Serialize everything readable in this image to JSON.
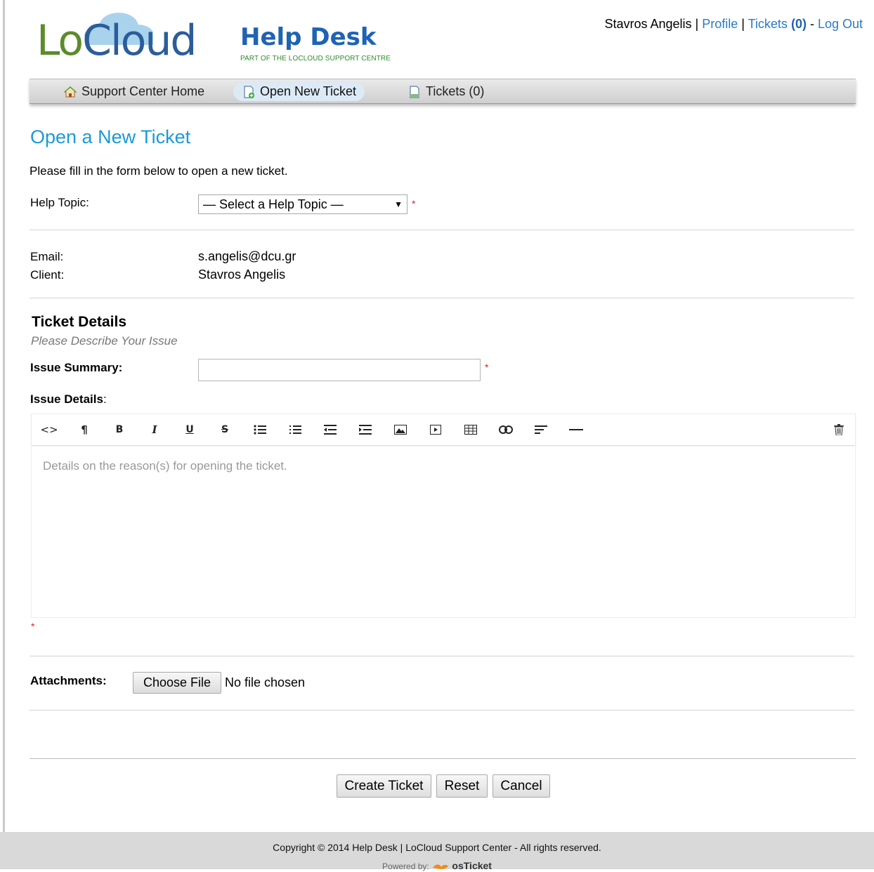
{
  "brand": {
    "logo_lo": "Lo",
    "logo_cloud": "Cloud",
    "logo_helpdesk": "Help Desk",
    "logo_sub": "PART OF THE LOCLOUD SUPPORT CENTRE",
    "colors": {
      "lo_green": "#5b8c2a",
      "cloud_blue": "#2b5d9a",
      "helpdesk_blue": "#1e63b4",
      "title_blue": "#1a9ad6",
      "required_red": "#e0242e"
    }
  },
  "user_bar": {
    "name": "Stavros Angelis",
    "sep1": " | ",
    "profile": "Profile",
    "sep2": " | ",
    "tickets": "Tickets",
    "tickets_count": "(0)",
    "sep3": " - ",
    "logout": "Log Out"
  },
  "nav": {
    "items": [
      {
        "label": "Support Center Home",
        "icon": "home-icon"
      },
      {
        "label": "Open New Ticket",
        "icon": "new-ticket-icon",
        "active": true
      },
      {
        "label": "Tickets (0)",
        "icon": "document-icon"
      }
    ]
  },
  "page": {
    "title": "Open a New Ticket",
    "intro": "Please fill in the form below to open a new ticket."
  },
  "form": {
    "help_topic_label": "Help Topic:",
    "help_topic_selected": "— Select a Help Topic —",
    "required_mark": "*",
    "email_label": "Email:",
    "email_value": "s.angelis@dcu.gr",
    "client_label": "Client:",
    "client_value": "Stavros Angelis",
    "details_title": "Ticket Details",
    "details_sub": "Please Describe Your Issue",
    "summary_label": "Issue Summary:",
    "details_label": "Issue Details",
    "details_colon": ":",
    "details_placeholder": "Details on the reason(s) for opening the ticket.",
    "attachments_label": "Attachments:",
    "choose_file": "Choose File",
    "no_file": "No file chosen"
  },
  "toolbar": {
    "buttons": [
      "html-icon",
      "paragraph-icon",
      "bold-icon",
      "italic-icon",
      "underline-icon",
      "strikethrough-icon",
      "bullet-list-icon",
      "numbered-list-icon",
      "outdent-icon",
      "indent-icon",
      "image-icon",
      "video-icon",
      "table-icon",
      "link-icon",
      "align-icon",
      "horizontal-rule-icon",
      "trash-icon"
    ],
    "glyphs": {
      "html": "<>",
      "paragraph": "¶",
      "bold": "B",
      "italic": "I",
      "underline": "U",
      "strike": "S"
    }
  },
  "actions": {
    "create": "Create Ticket",
    "reset": "Reset",
    "cancel": "Cancel"
  },
  "footer": {
    "copyright": "Copyright © 2014 Help Desk | LoCloud Support Center - All rights reserved.",
    "powered_by": "Powered by:",
    "osticket": "osTicket"
  }
}
